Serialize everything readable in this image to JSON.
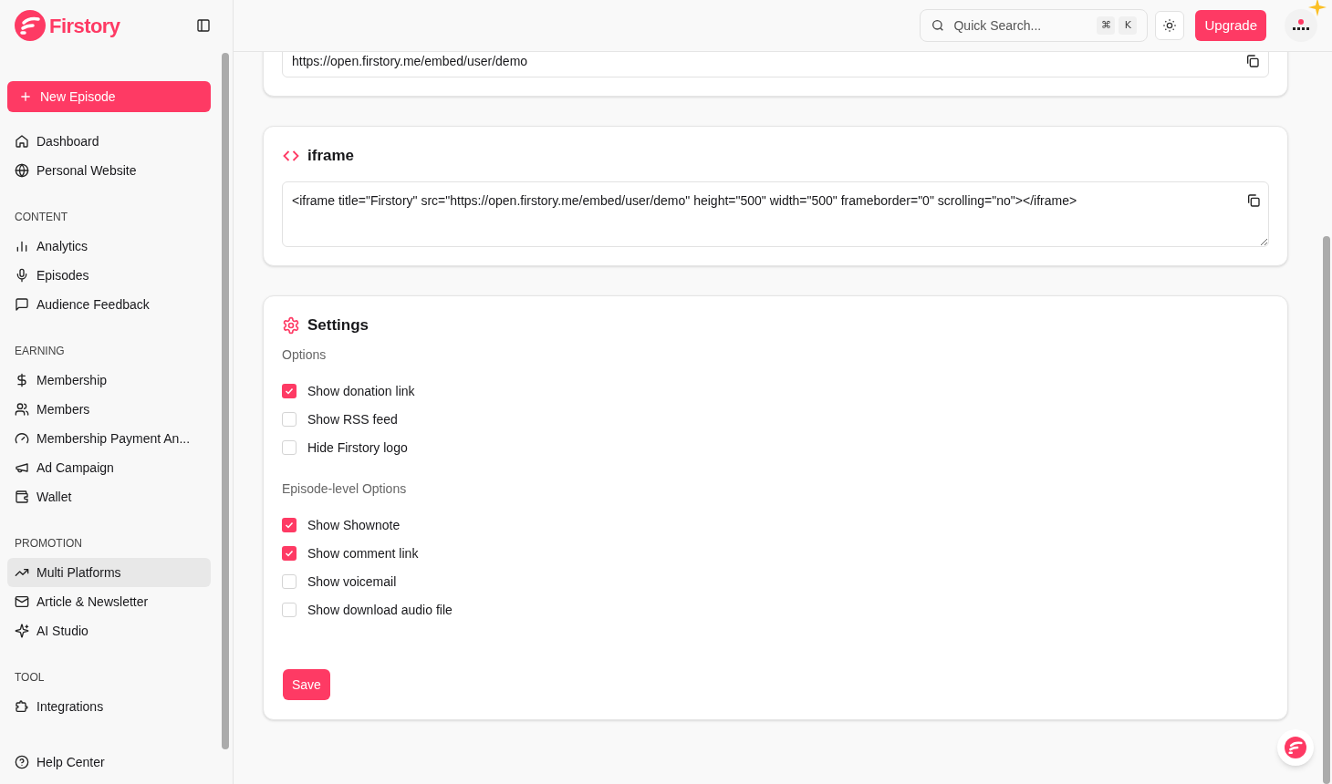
{
  "sidebar": {
    "logo": "Firstory",
    "new_episode": "New Episode",
    "sections": [
      {
        "items": [
          {
            "label": "Dashboard",
            "selected": false
          },
          {
            "label": "Personal Website",
            "selected": false
          }
        ]
      },
      {
        "heading": "CONTENT",
        "items": [
          {
            "label": "Analytics",
            "selected": false
          },
          {
            "label": "Episodes",
            "selected": false
          },
          {
            "label": "Audience Feedback",
            "selected": false
          }
        ]
      },
      {
        "heading": "EARNING",
        "items": [
          {
            "label": "Membership",
            "selected": false
          },
          {
            "label": "Members",
            "selected": false
          },
          {
            "label": "Membership Payment An...",
            "selected": false
          },
          {
            "label": "Ad Campaign",
            "selected": false
          },
          {
            "label": "Wallet",
            "selected": false
          }
        ]
      },
      {
        "heading": "PROMOTION",
        "items": [
          {
            "label": "Multi Platforms",
            "selected": true
          },
          {
            "label": "Article & Newsletter",
            "selected": false
          },
          {
            "label": "AI Studio",
            "selected": false
          }
        ]
      },
      {
        "heading": "TOOL",
        "items": [
          {
            "label": "Integrations",
            "selected": false
          }
        ]
      }
    ],
    "footer_item": {
      "label": "Help Center",
      "selected": false
    }
  },
  "header": {
    "search": {
      "placeholder": "Quick Search...",
      "keys": [
        "⌘",
        "K"
      ]
    },
    "upgrade": "Upgrade"
  },
  "embed_link": {
    "value": "https://open.firstory.me/embed/user/demo"
  },
  "iframe": {
    "title": "iframe",
    "value": "<iframe title=\"Firstory\" src=\"https://open.firstory.me/embed/user/demo\" height=\"500\" width=\"500\" frameborder=\"0\" scrolling=\"no\"></iframe>"
  },
  "settings": {
    "title": "Settings",
    "groups": [
      {
        "label": "Options",
        "options": [
          {
            "label": "Show donation link",
            "checked": true
          },
          {
            "label": "Show RSS feed",
            "checked": false
          },
          {
            "label": "Hide Firstory logo",
            "checked": false
          }
        ]
      },
      {
        "label": "Episode-level Options",
        "options": [
          {
            "label": "Show Shownote",
            "checked": true
          },
          {
            "label": "Show comment link",
            "checked": true
          },
          {
            "label": "Show voicemail",
            "checked": false
          },
          {
            "label": "Show download audio file",
            "checked": false
          }
        ]
      }
    ],
    "save": "Save"
  }
}
